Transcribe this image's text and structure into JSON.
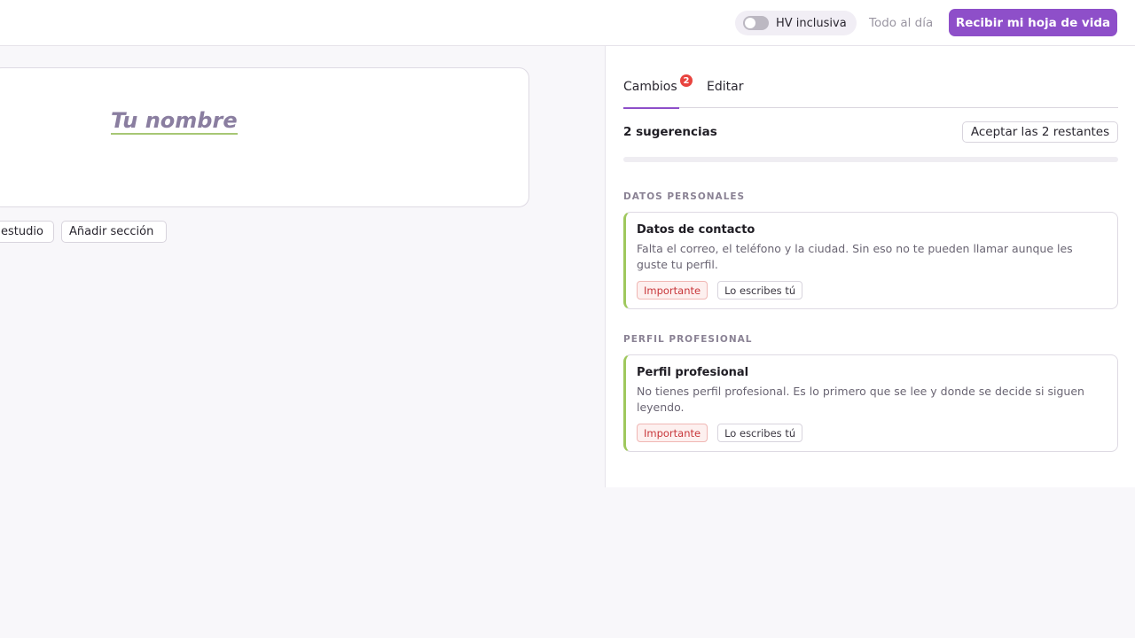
{
  "topbar": {
    "toggle_label": "HV inclusiva",
    "toggle_on": false,
    "status": "Todo al día",
    "cta_label": "Recibir mi hoja de vida",
    "accent_color": "#8e4fc9"
  },
  "editor": {
    "name_placeholder": "Tu nombre",
    "buttons": {
      "study": "estudio",
      "add_section": "Añadir sección"
    }
  },
  "panel": {
    "tabs": [
      {
        "label": "Cambios",
        "badge": "2",
        "active": true
      },
      {
        "label": "Editar",
        "active": false
      }
    ],
    "suggestion_count": "2 sugerencias",
    "accept_all": "Aceptar las 2 restantes",
    "progress_fraction": 0,
    "sections": [
      {
        "label": "DATOS PERSONALES",
        "card": {
          "title": "Datos de contacto",
          "description": "Falta el correo, el teléfono y la ciudad. Sin eso no te pueden llamar aunque les guste tu perfil.",
          "tags": [
            "Importante",
            "Lo escribes tú"
          ]
        }
      },
      {
        "label": "PERFIL PROFESIONAL",
        "card": {
          "title": "Perfil profesional",
          "description": "No tienes perfil profesional. Es lo primero que se lee y donde se decide si siguen leyendo.",
          "tags": [
            "Importante",
            "Lo escribes tú"
          ]
        }
      }
    ]
  }
}
